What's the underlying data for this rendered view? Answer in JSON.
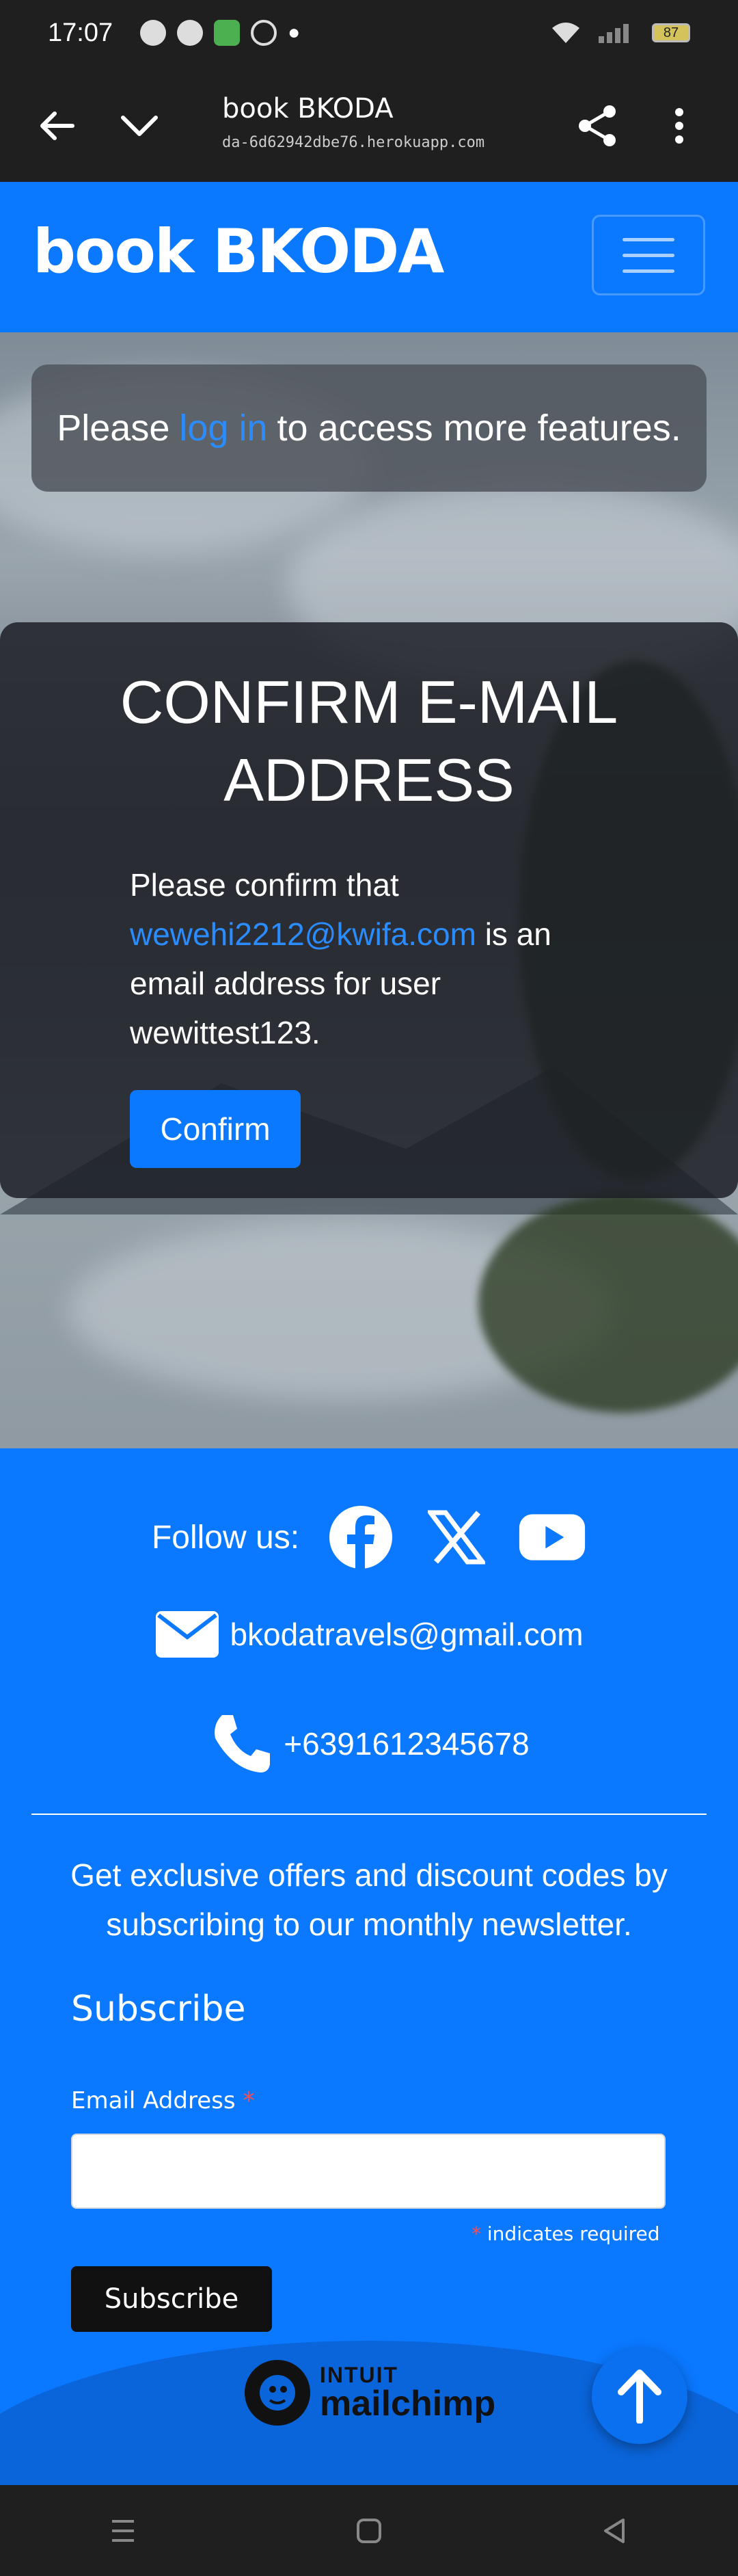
{
  "status_bar": {
    "time": "17:07",
    "battery": "87"
  },
  "browser": {
    "title": "book BKODA",
    "url": "da-6d62942dbe76.herokuapp.com"
  },
  "navbar": {
    "brand": "book BKODA"
  },
  "alert": {
    "before": "Please",
    "link": "log in",
    "after": "to access more features."
  },
  "confirm": {
    "title": "CONFIRM E-MAIL ADDRESS",
    "text_before": "Please confirm that",
    "email": "wewehi2212@kwifa.com",
    "text_after": "is an email address for user wewittest123.",
    "button": "Confirm"
  },
  "footer": {
    "follow_label": "Follow us:",
    "email": "bkodatravels@gmail.com",
    "phone": "+6391612345678",
    "newsletter": "Get exclusive offers and discount codes by subscribing to our monthly newsletter.",
    "subscribe_heading": "Subscribe",
    "email_label": "Email Address",
    "required_note": "indicates required",
    "subscribe_button": "Subscribe",
    "mailchimp_top": "INTUIT",
    "mailchimp_word": "mailchimp"
  },
  "colors": {
    "primary": "#0a78ff",
    "link": "#2a8cff",
    "card": "#1c1e24"
  }
}
